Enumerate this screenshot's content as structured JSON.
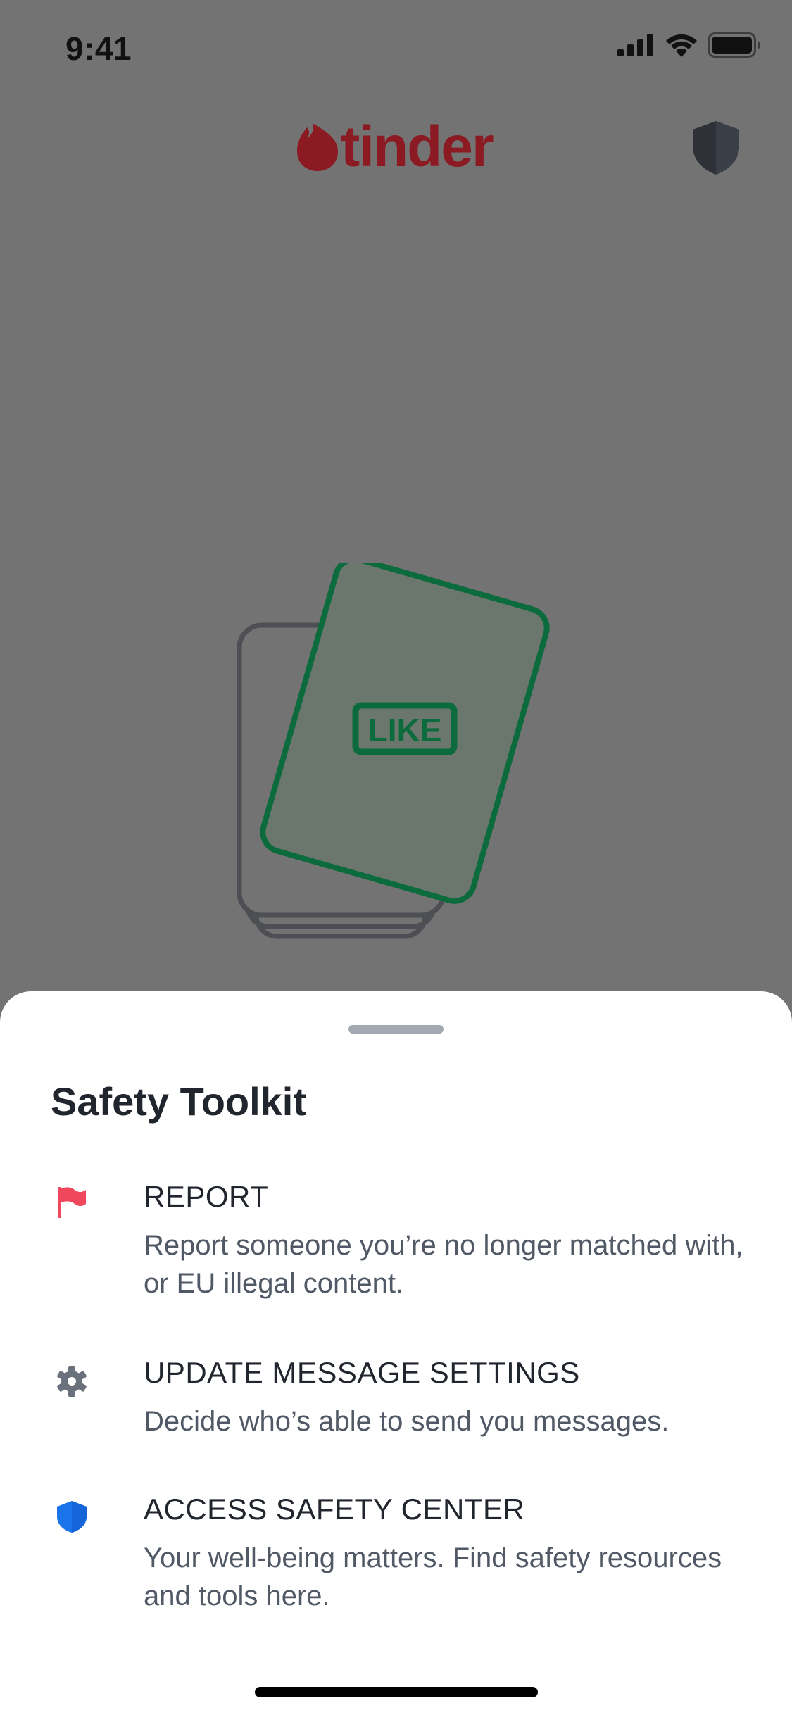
{
  "status_bar": {
    "time": "9:41",
    "icons": [
      "cellular-signal-icon",
      "wifi-icon",
      "battery-icon"
    ]
  },
  "header": {
    "brand": "tinder",
    "brand_color": "#8b1a22",
    "right_icon": "shield-icon"
  },
  "illustration": {
    "stamp_text": "LIKE",
    "accent_color": "#0c6b3c"
  },
  "sheet": {
    "title": "Safety Toolkit",
    "options": [
      {
        "icon": "flag-icon",
        "icon_color": "#f0475c",
        "title": "REPORT",
        "description": "Report someone you’re no longer matched with, or EU illegal content."
      },
      {
        "icon": "gear-icon",
        "icon_color": "#6b717c",
        "title": "UPDATE MESSAGE SETTINGS",
        "description": "Decide who’s able to send you messages."
      },
      {
        "icon": "shield-icon",
        "icon_color": "#1a73e8",
        "title": "ACCESS SAFETY CENTER",
        "description": "Your well-being matters. Find safety resources and tools here."
      }
    ]
  }
}
